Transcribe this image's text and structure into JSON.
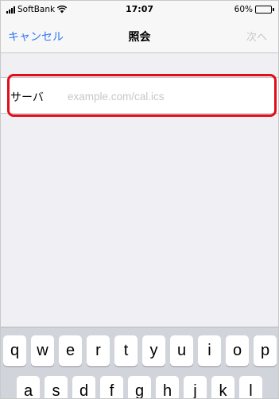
{
  "status_bar": {
    "carrier": "SoftBank",
    "time": "17:07",
    "battery_percent": "60%",
    "battery_level": 0.6,
    "signal_icon": "signal-bars-icon",
    "wifi_icon": "wifi-icon",
    "battery_icon": "battery-icon"
  },
  "nav": {
    "cancel_label": "キャンセル",
    "title": "照会",
    "next_label": "次へ"
  },
  "form": {
    "server_label": "サーバ",
    "server_value": "",
    "server_placeholder": "example.com/cal.ics"
  },
  "keyboard": {
    "row1": [
      "q",
      "w",
      "e",
      "r",
      "t",
      "y",
      "u",
      "i",
      "o",
      "p"
    ],
    "row2": [
      "a",
      "s",
      "d",
      "f",
      "g",
      "h",
      "j",
      "k",
      "l"
    ]
  },
  "colors": {
    "accent": "#3478f6",
    "disabled": "#c7c7cc",
    "highlight": "#e10d18",
    "background": "#efeff4"
  }
}
